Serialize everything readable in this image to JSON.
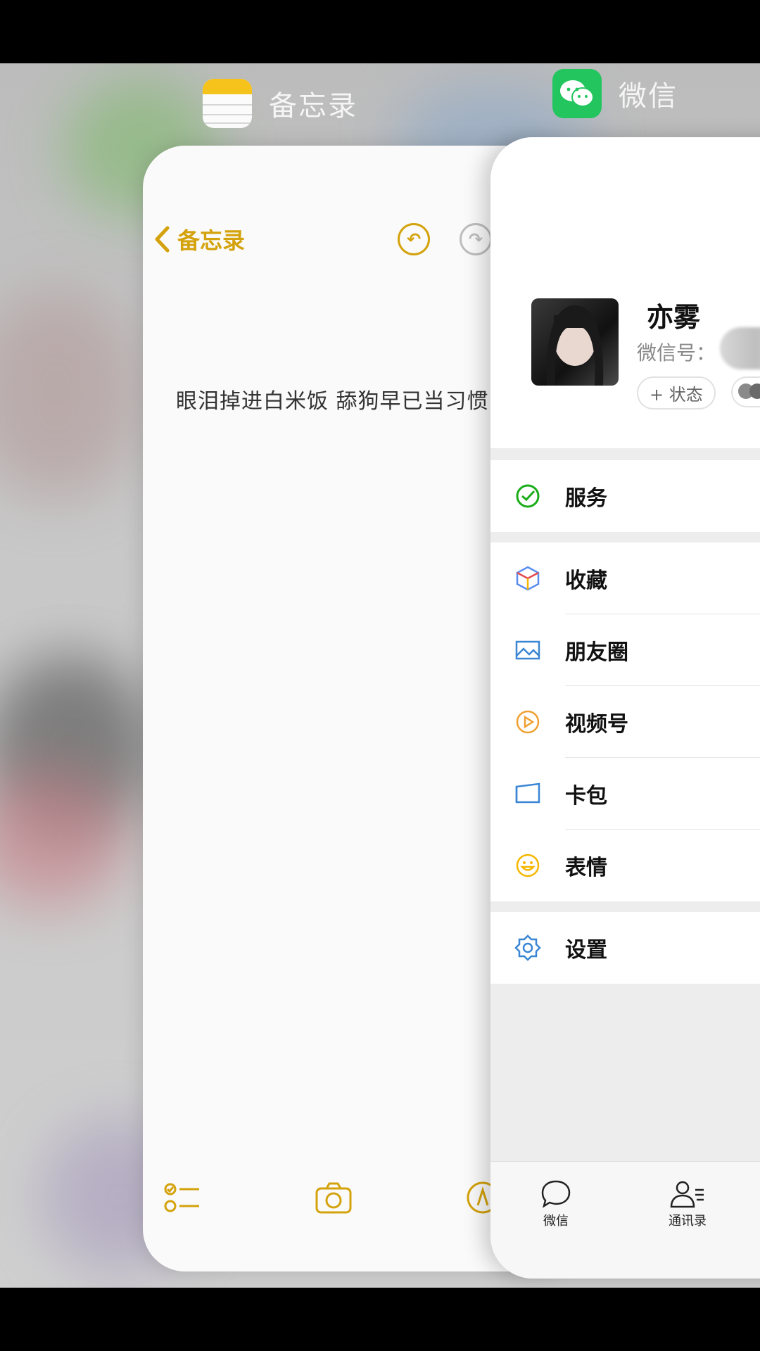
{
  "switcher": {
    "notes_app_name": "备忘录",
    "wechat_app_name": "微信"
  },
  "notes": {
    "back_label": "备忘录",
    "content_text": "眼泪掉进白米饭 舔狗早已当习惯",
    "accent_color": "#d4a20c"
  },
  "wechat": {
    "profile": {
      "nickname": "亦雾",
      "wechat_id_label": "微信号：",
      "status_button": "+ 状态"
    },
    "menu": {
      "service": "服务",
      "favorites": "收藏",
      "moments": "朋友圈",
      "channels": "视频号",
      "cards": "卡包",
      "stickers": "表情",
      "settings": "设置"
    },
    "tabs": {
      "chats": "微信",
      "contacts": "通讯录"
    },
    "brand_color": "#22c55e"
  }
}
